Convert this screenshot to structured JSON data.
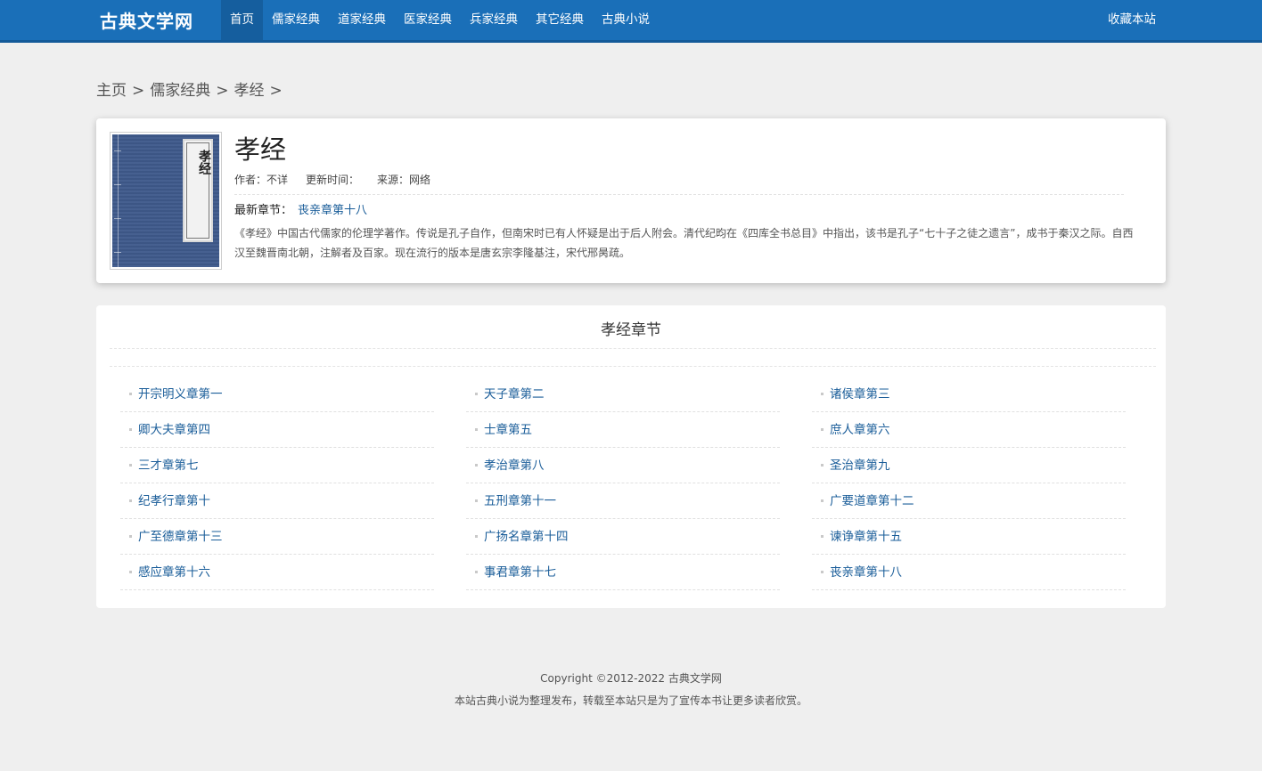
{
  "site": {
    "name": "古典文学网",
    "nav": [
      "首页",
      "儒家经典",
      "道家经典",
      "医家经典",
      "兵家经典",
      "其它经典",
      "古典小说"
    ],
    "active_index": 0,
    "favorite_label": "收藏本站"
  },
  "breadcrumb": {
    "items": [
      "主页",
      "儒家经典",
      "孝经"
    ],
    "separator": ">"
  },
  "book": {
    "cover_title": "孝经",
    "title": "孝经",
    "author": "作者：不详",
    "updated": "更新时间：",
    "source": "来源：网络",
    "latest_label": "最新章节：",
    "latest_chapter": "丧亲章第十八",
    "description": "《孝经》中国古代儒家的伦理学著作。传说是孔子自作，但南宋时已有人怀疑是出于后人附会。清代纪昀在《四库全书总目》中指出，该书是孔子“七十子之徒之遗言”，成书于秦汉之际。自西汉至魏晋南北朝，注解者及百家。现在流行的版本是唐玄宗李隆基注，宋代邢昺疏。"
  },
  "chapters": {
    "heading": "孝经章节",
    "items": [
      "开宗明义章第一",
      "天子章第二",
      "诸侯章第三",
      "卿大夫章第四",
      "士章第五",
      "庶人章第六",
      "三才章第七",
      "孝治章第八",
      "圣治章第九",
      "纪孝行章第十",
      "五刑章第十一",
      "广要道章第十二",
      "广至德章第十三",
      "广扬名章第十四",
      "谏诤章第十五",
      "感应章第十六",
      "事君章第十七",
      "丧亲章第十八"
    ]
  },
  "footer": {
    "copyright": "Copyright ©2012-2022 古典文学网",
    "notice": "本站古典小说为整理发布，转载至本站只是为了宣传本书让更多读者欣赏。"
  },
  "colors": {
    "nav_bg": "#1a6fb8",
    "link": "#1a5d99",
    "cover": "#3f5a8c"
  }
}
